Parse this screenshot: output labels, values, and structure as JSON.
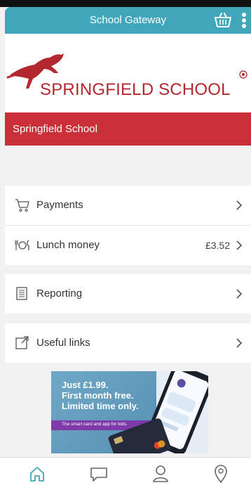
{
  "app": {
    "title": "School Gateway"
  },
  "header": {
    "basket_icon": "basket-icon",
    "menu_icon": "more-vertical-icon"
  },
  "logo": {
    "text": "SPRINGFIELD SCHOOL"
  },
  "school": {
    "name": "Springfield School"
  },
  "menu": {
    "payments": {
      "label": "Payments",
      "icon": "cart-icon"
    },
    "lunch": {
      "label": "Lunch money",
      "value": "£3.52",
      "icon": "cutlery-icon"
    },
    "reporting": {
      "label": "Reporting",
      "icon": "report-icon"
    },
    "links": {
      "label": "Useful links",
      "icon": "external-link-icon"
    }
  },
  "banner": {
    "headline_1": "Just £1.99.",
    "headline_2": "First month free.",
    "headline_3": "Limited time only.",
    "tagline": "The smart card and app for kids."
  },
  "tabbar": {
    "items": [
      {
        "icon": "home-icon"
      },
      {
        "icon": "chat-icon"
      },
      {
        "icon": "user-icon"
      },
      {
        "icon": "location-icon"
      }
    ]
  },
  "colors": {
    "header": "#3fa7b9",
    "brand_red": "#c9303a",
    "active_tab": "#3fa7b9"
  }
}
